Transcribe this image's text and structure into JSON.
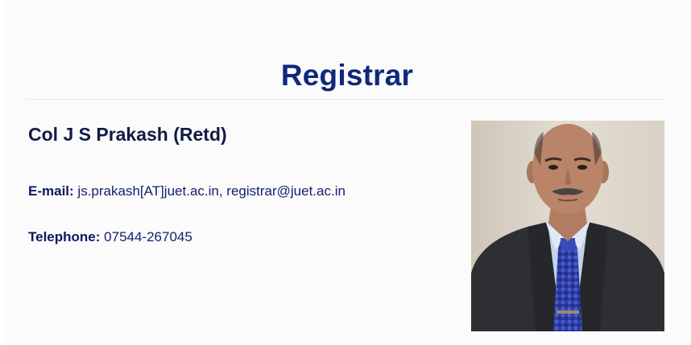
{
  "page": {
    "title": "Registrar"
  },
  "profile": {
    "name": "Col J S Prakash (Retd)",
    "email_label": "E-mail:",
    "email_value": "js.prakash[AT]juet.ac.in, registrar@juet.ac.in",
    "phone_label": "Telephone:",
    "phone_value": "07544-267045"
  },
  "colors": {
    "title": "#10287a",
    "name": "#111b45",
    "text": "#15206b",
    "background": "#fbfbfc"
  }
}
